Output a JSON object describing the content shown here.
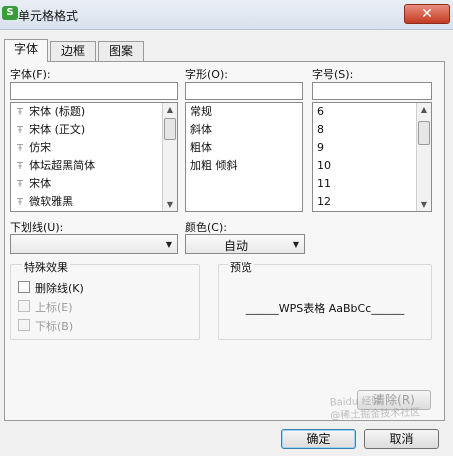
{
  "window": {
    "title": "单元格格式",
    "app_icon_letter": "S",
    "close_glyph": "✕"
  },
  "tabs": [
    {
      "label": "字体",
      "active": true
    },
    {
      "label": "边框",
      "active": false
    },
    {
      "label": "图案",
      "active": false
    }
  ],
  "font": {
    "label": "字体(F):",
    "value": "",
    "items": [
      "宋体 (标题)",
      "宋体 (正文)",
      "仿宋",
      "体坛超黑简体",
      "宋体",
      "微软雅黑"
    ],
    "truetype_glyph": "Ŧ"
  },
  "style": {
    "label": "字形(O):",
    "value": "",
    "items": [
      "常规",
      "斜体",
      "粗体",
      "加粗 倾斜"
    ]
  },
  "size": {
    "label": "字号(S):",
    "value": "",
    "items": [
      "6",
      "8",
      "9",
      "10",
      "11",
      "12"
    ]
  },
  "underline": {
    "label": "下划线(U):",
    "value": ""
  },
  "color": {
    "label": "颜色(C):",
    "value": "自动"
  },
  "effects": {
    "label": "特殊效果",
    "strikethrough": "删除线(K)",
    "superscript": "上标(E)",
    "subscript": "下标(B)"
  },
  "preview": {
    "label": "预览",
    "text": "______WPS表格  AaBbCc______"
  },
  "buttons": {
    "clear": "清除(R)",
    "ok": "确定",
    "cancel": "取消"
  },
  "watermark": {
    "line1": "Baidu 经验",
    "line2": "@稀土掘金技术社区"
  },
  "colors": {
    "close_red": "#c23b23",
    "app_green": "#3a9b3a",
    "default_button_border": "#3c7fb1"
  }
}
